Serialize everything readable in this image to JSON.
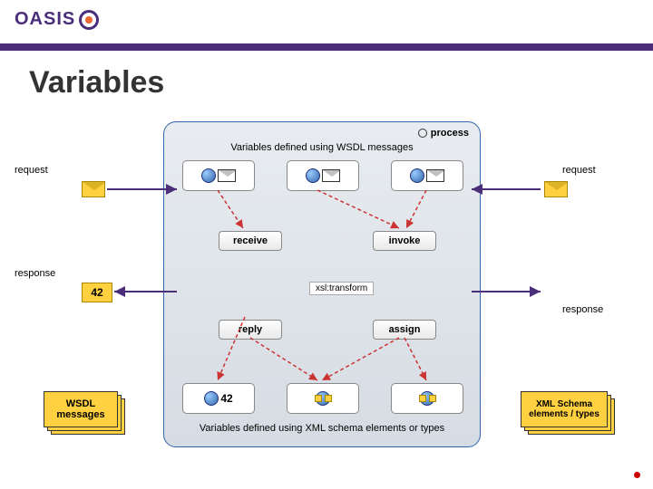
{
  "logo": "OASIS",
  "title": "Variables",
  "process_label": "process",
  "caption_top": "Variables defined using WSDL messages",
  "caption_bottom": "Variables defined using XML schema elements or types",
  "labels": {
    "request_left": "request",
    "request_right": "request",
    "response_left": "response",
    "response_right": "response"
  },
  "activities": {
    "receive": "receive",
    "invoke": "invoke",
    "reply": "reply",
    "assign": "assign"
  },
  "xsl": "xsl:transform",
  "val42": "42",
  "stacks": {
    "wsdl": "WSDL messages",
    "xml": "XML Schema elements / types"
  }
}
